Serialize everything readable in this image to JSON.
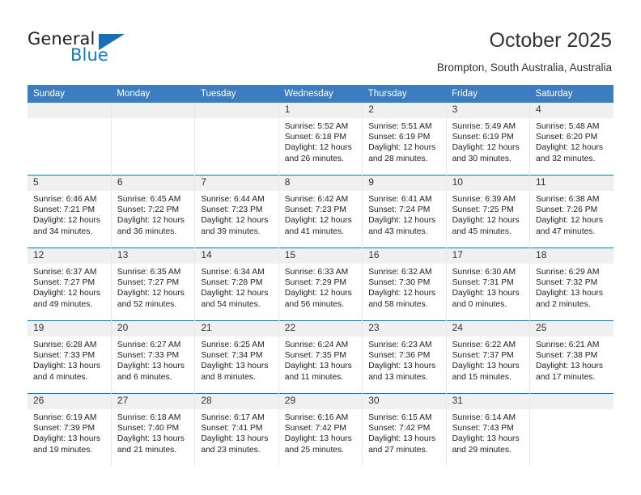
{
  "logo": {
    "text_top": "General",
    "text_bottom": "Blue",
    "accent_color": "#1878be",
    "triangle_color": "#1d6fb5",
    "icon": "general-blue-logo"
  },
  "header": {
    "title": "October 2025",
    "subtitle": "Brompton, South Australia, Australia"
  },
  "calendar": {
    "header_color": "#3b7dc0",
    "weekdays": [
      "Sunday",
      "Monday",
      "Tuesday",
      "Wednesday",
      "Thursday",
      "Friday",
      "Saturday"
    ],
    "weeks": [
      [
        {
          "day": "",
          "lines": []
        },
        {
          "day": "",
          "lines": []
        },
        {
          "day": "",
          "lines": []
        },
        {
          "day": "1",
          "lines": [
            "Sunrise: 5:52 AM",
            "Sunset: 6:18 PM",
            "Daylight: 12 hours",
            "and 26 minutes."
          ]
        },
        {
          "day": "2",
          "lines": [
            "Sunrise: 5:51 AM",
            "Sunset: 6:19 PM",
            "Daylight: 12 hours",
            "and 28 minutes."
          ]
        },
        {
          "day": "3",
          "lines": [
            "Sunrise: 5:49 AM",
            "Sunset: 6:19 PM",
            "Daylight: 12 hours",
            "and 30 minutes."
          ]
        },
        {
          "day": "4",
          "lines": [
            "Sunrise: 5:48 AM",
            "Sunset: 6:20 PM",
            "Daylight: 12 hours",
            "and 32 minutes."
          ]
        }
      ],
      [
        {
          "day": "5",
          "lines": [
            "Sunrise: 6:46 AM",
            "Sunset: 7:21 PM",
            "Daylight: 12 hours",
            "and 34 minutes."
          ]
        },
        {
          "day": "6",
          "lines": [
            "Sunrise: 6:45 AM",
            "Sunset: 7:22 PM",
            "Daylight: 12 hours",
            "and 36 minutes."
          ]
        },
        {
          "day": "7",
          "lines": [
            "Sunrise: 6:44 AM",
            "Sunset: 7:23 PM",
            "Daylight: 12 hours",
            "and 39 minutes."
          ]
        },
        {
          "day": "8",
          "lines": [
            "Sunrise: 6:42 AM",
            "Sunset: 7:23 PM",
            "Daylight: 12 hours",
            "and 41 minutes."
          ]
        },
        {
          "day": "9",
          "lines": [
            "Sunrise: 6:41 AM",
            "Sunset: 7:24 PM",
            "Daylight: 12 hours",
            "and 43 minutes."
          ]
        },
        {
          "day": "10",
          "lines": [
            "Sunrise: 6:39 AM",
            "Sunset: 7:25 PM",
            "Daylight: 12 hours",
            "and 45 minutes."
          ]
        },
        {
          "day": "11",
          "lines": [
            "Sunrise: 6:38 AM",
            "Sunset: 7:26 PM",
            "Daylight: 12 hours",
            "and 47 minutes."
          ]
        }
      ],
      [
        {
          "day": "12",
          "lines": [
            "Sunrise: 6:37 AM",
            "Sunset: 7:27 PM",
            "Daylight: 12 hours",
            "and 49 minutes."
          ]
        },
        {
          "day": "13",
          "lines": [
            "Sunrise: 6:35 AM",
            "Sunset: 7:27 PM",
            "Daylight: 12 hours",
            "and 52 minutes."
          ]
        },
        {
          "day": "14",
          "lines": [
            "Sunrise: 6:34 AM",
            "Sunset: 7:28 PM",
            "Daylight: 12 hours",
            "and 54 minutes."
          ]
        },
        {
          "day": "15",
          "lines": [
            "Sunrise: 6:33 AM",
            "Sunset: 7:29 PM",
            "Daylight: 12 hours",
            "and 56 minutes."
          ]
        },
        {
          "day": "16",
          "lines": [
            "Sunrise: 6:32 AM",
            "Sunset: 7:30 PM",
            "Daylight: 12 hours",
            "and 58 minutes."
          ]
        },
        {
          "day": "17",
          "lines": [
            "Sunrise: 6:30 AM",
            "Sunset: 7:31 PM",
            "Daylight: 13 hours",
            "and 0 minutes."
          ]
        },
        {
          "day": "18",
          "lines": [
            "Sunrise: 6:29 AM",
            "Sunset: 7:32 PM",
            "Daylight: 13 hours",
            "and 2 minutes."
          ]
        }
      ],
      [
        {
          "day": "19",
          "lines": [
            "Sunrise: 6:28 AM",
            "Sunset: 7:33 PM",
            "Daylight: 13 hours",
            "and 4 minutes."
          ]
        },
        {
          "day": "20",
          "lines": [
            "Sunrise: 6:27 AM",
            "Sunset: 7:33 PM",
            "Daylight: 13 hours",
            "and 6 minutes."
          ]
        },
        {
          "day": "21",
          "lines": [
            "Sunrise: 6:25 AM",
            "Sunset: 7:34 PM",
            "Daylight: 13 hours",
            "and 8 minutes."
          ]
        },
        {
          "day": "22",
          "lines": [
            "Sunrise: 6:24 AM",
            "Sunset: 7:35 PM",
            "Daylight: 13 hours",
            "and 11 minutes."
          ]
        },
        {
          "day": "23",
          "lines": [
            "Sunrise: 6:23 AM",
            "Sunset: 7:36 PM",
            "Daylight: 13 hours",
            "and 13 minutes."
          ]
        },
        {
          "day": "24",
          "lines": [
            "Sunrise: 6:22 AM",
            "Sunset: 7:37 PM",
            "Daylight: 13 hours",
            "and 15 minutes."
          ]
        },
        {
          "day": "25",
          "lines": [
            "Sunrise: 6:21 AM",
            "Sunset: 7:38 PM",
            "Daylight: 13 hours",
            "and 17 minutes."
          ]
        }
      ],
      [
        {
          "day": "26",
          "lines": [
            "Sunrise: 6:19 AM",
            "Sunset: 7:39 PM",
            "Daylight: 13 hours",
            "and 19 minutes."
          ]
        },
        {
          "day": "27",
          "lines": [
            "Sunrise: 6:18 AM",
            "Sunset: 7:40 PM",
            "Daylight: 13 hours",
            "and 21 minutes."
          ]
        },
        {
          "day": "28",
          "lines": [
            "Sunrise: 6:17 AM",
            "Sunset: 7:41 PM",
            "Daylight: 13 hours",
            "and 23 minutes."
          ]
        },
        {
          "day": "29",
          "lines": [
            "Sunrise: 6:16 AM",
            "Sunset: 7:42 PM",
            "Daylight: 13 hours",
            "and 25 minutes."
          ]
        },
        {
          "day": "30",
          "lines": [
            "Sunrise: 6:15 AM",
            "Sunset: 7:42 PM",
            "Daylight: 13 hours",
            "and 27 minutes."
          ]
        },
        {
          "day": "31",
          "lines": [
            "Sunrise: 6:14 AM",
            "Sunset: 7:43 PM",
            "Daylight: 13 hours",
            "and 29 minutes."
          ]
        },
        {
          "day": "",
          "lines": []
        }
      ]
    ]
  }
}
